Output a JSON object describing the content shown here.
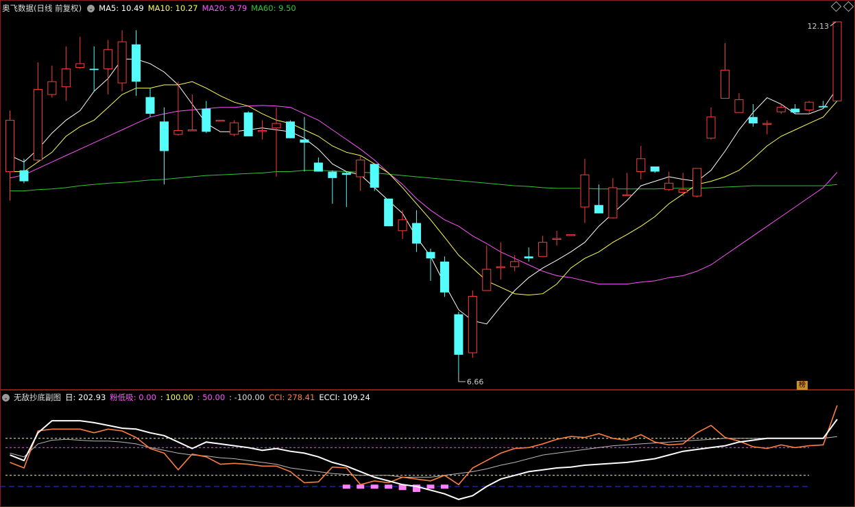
{
  "header": {
    "title": "奥飞数据(日线 前复权)",
    "ma5": "MA5: 10.49",
    "ma10": "MA10: 10.27",
    "ma20": "MA20: 9.79",
    "ma60": "MA60: 9.50"
  },
  "subheader": {
    "title": "无敌抄底副图",
    "ri": "日: 202.93",
    "fendixi": "粉低吸: 0.00",
    "l100": ": 100.00",
    "l50": ": 50.00",
    "lm100": ": -100.00",
    "cci": "CCI: 278.41",
    "ecci": "ECCI: 109.24"
  },
  "bang_label": "榜",
  "colors": {
    "up": "#ff3c3c",
    "down": "#54fcfc",
    "ma5": "#ffffff",
    "ma10": "#ffff54",
    "ma20": "#ff54ff",
    "ma60": "#32c832",
    "cci": "#ff7f40",
    "ri": "#ffffff",
    "pink": "#ff80ff"
  },
  "chart_data": [
    {
      "type": "candlestick",
      "high_label": "12.13",
      "low_label": "6.66",
      "candles": [
        [
          9.8,
          10.6,
          10.75,
          9.35
        ],
        [
          9.82,
          9.65,
          10.0,
          9.62
        ],
        [
          9.98,
          11.08,
          11.5,
          9.96
        ],
        [
          11.0,
          11.2,
          11.45,
          10.95
        ],
        [
          11.12,
          11.4,
          11.75,
          10.9
        ],
        [
          11.42,
          11.48,
          11.9,
          11.4
        ],
        [
          11.4,
          11.38,
          11.75,
          11.05
        ],
        [
          11.4,
          11.7,
          11.85,
          11.0
        ],
        [
          11.18,
          11.82,
          12.0,
          11.05
        ],
        [
          11.78,
          11.2,
          12.0,
          10.98
        ],
        [
          10.96,
          10.7,
          11.1,
          10.65
        ],
        [
          10.58,
          10.12,
          10.8,
          9.6
        ],
        [
          10.38,
          10.44,
          11.2,
          10.36
        ],
        [
          10.44,
          10.45,
          11.0,
          10.43
        ],
        [
          10.78,
          10.42,
          10.9,
          10.4
        ],
        [
          10.6,
          10.6,
          10.6,
          10.6
        ],
        [
          10.38,
          10.56,
          10.6,
          10.35
        ],
        [
          10.72,
          10.35,
          10.74,
          10.35
        ],
        [
          10.44,
          10.44,
          10.6,
          10.3
        ],
        [
          10.48,
          10.55,
          10.8,
          9.72
        ],
        [
          10.58,
          10.32,
          10.6,
          10.32
        ],
        [
          10.3,
          10.25,
          10.65,
          9.8
        ],
        [
          9.94,
          9.8,
          10.02,
          9.8
        ],
        [
          9.8,
          9.7,
          9.82,
          9.3
        ],
        [
          9.78,
          9.75,
          9.8,
          9.25
        ],
        [
          9.72,
          9.98,
          10.05,
          9.5
        ],
        [
          9.92,
          9.55,
          9.92,
          9.5
        ],
        [
          9.38,
          8.95,
          9.38,
          8.95
        ],
        [
          8.88,
          9.05,
          9.2,
          8.75
        ],
        [
          9.0,
          8.68,
          9.2,
          8.55
        ],
        [
          8.55,
          8.45,
          8.6,
          8.1
        ],
        [
          8.4,
          7.92,
          8.48,
          7.85
        ],
        [
          7.58,
          6.95,
          7.62,
          6.66
        ],
        [
          6.98,
          7.86,
          7.95,
          6.9
        ],
        [
          7.95,
          8.28,
          8.65,
          7.95
        ],
        [
          8.32,
          8.32,
          8.7,
          8.12
        ],
        [
          8.32,
          8.4,
          8.5,
          8.25
        ],
        [
          8.48,
          8.45,
          8.62,
          8.4
        ],
        [
          8.48,
          8.7,
          8.8,
          8.5
        ],
        [
          8.75,
          8.76,
          8.88,
          8.65
        ],
        [
          8.82,
          8.82,
          8.82,
          8.82
        ],
        [
          9.25,
          9.75,
          10.0,
          9.0
        ],
        [
          9.28,
          9.15,
          9.6,
          9.15
        ],
        [
          9.08,
          9.55,
          9.7,
          9.07
        ],
        [
          9.44,
          9.44,
          9.78,
          9.42
        ],
        [
          9.8,
          10.0,
          10.2,
          9.68
        ],
        [
          9.88,
          9.8,
          9.88,
          9.78
        ],
        [
          9.52,
          9.62,
          9.8,
          9.5
        ],
        [
          9.48,
          9.52,
          9.78,
          9.42
        ],
        [
          9.42,
          9.85,
          9.85,
          9.4
        ],
        [
          10.32,
          10.65,
          10.8,
          10.3
        ],
        [
          10.94,
          11.38,
          11.8,
          10.94
        ],
        [
          10.72,
          10.92,
          11.02,
          10.78
        ],
        [
          10.65,
          10.55,
          10.85,
          10.5
        ],
        [
          10.55,
          10.55,
          10.6,
          10.38
        ],
        [
          10.73,
          10.8,
          10.85,
          10.7
        ],
        [
          10.78,
          10.72,
          10.85,
          10.7
        ],
        [
          10.76,
          10.88,
          10.9,
          10.7
        ],
        [
          10.82,
          10.8,
          10.9,
          10.8
        ],
        [
          10.9,
          12.13,
          12.13,
          10.9
        ]
      ],
      "ma5": [
        10.05,
        9.95,
        10.15,
        10.4,
        10.6,
        10.75,
        11.05,
        11.25,
        11.55,
        11.55,
        11.48,
        11.35,
        11.15,
        10.85,
        10.55,
        10.42,
        10.42,
        10.45,
        10.48,
        10.45,
        10.42,
        10.32,
        10.15,
        9.92,
        9.8,
        9.75,
        9.55,
        9.35,
        9.15,
        8.78,
        8.48,
        8.05,
        7.65,
        7.48,
        7.43,
        7.7,
        7.95,
        8.15,
        8.3,
        8.42,
        8.55,
        8.7,
        8.95,
        9.15,
        9.35,
        9.58,
        9.65,
        9.72,
        9.68,
        9.65,
        9.82,
        10.12,
        10.45,
        10.72,
        10.95,
        10.85,
        10.7,
        10.7,
        10.78,
        11.1
      ],
      "ma10": [
        9.8,
        9.8,
        9.95,
        10.1,
        10.35,
        10.5,
        10.6,
        10.8,
        11.0,
        11.1,
        11.1,
        11.15,
        11.15,
        11.2,
        11.1,
        10.98,
        10.88,
        10.82,
        10.7,
        10.6,
        10.55,
        10.45,
        10.35,
        10.2,
        10.1,
        10.05,
        9.92,
        9.78,
        9.55,
        9.3,
        9.05,
        8.78,
        8.5,
        8.3,
        8.1,
        8.0,
        7.9,
        7.88,
        7.9,
        8.05,
        8.3,
        8.45,
        8.55,
        8.7,
        8.82,
        8.95,
        9.1,
        9.3,
        9.45,
        9.6,
        9.65,
        9.72,
        9.82,
        10.0,
        10.2,
        10.35,
        10.45,
        10.55,
        10.65,
        10.9
      ],
      "ma20": [
        9.7,
        9.75,
        9.85,
        9.95,
        10.05,
        10.15,
        10.25,
        10.35,
        10.45,
        10.55,
        10.65,
        10.7,
        10.74,
        10.76,
        10.78,
        10.8,
        10.8,
        10.82,
        10.83,
        10.82,
        10.8,
        10.7,
        10.6,
        10.45,
        10.3,
        10.15,
        9.98,
        9.78,
        9.6,
        9.38,
        9.2,
        9.05,
        8.95,
        8.8,
        8.68,
        8.55,
        8.45,
        8.35,
        8.25,
        8.18,
        8.15,
        8.1,
        8.05,
        8.05,
        8.05,
        8.08,
        8.1,
        8.15,
        8.18,
        8.25,
        8.35,
        8.5,
        8.65,
        8.8,
        8.95,
        9.1,
        9.25,
        9.4,
        9.55,
        9.79
      ],
      "ma60": [
        9.5,
        9.5,
        9.52,
        9.53,
        9.55,
        9.58,
        9.6,
        9.62,
        9.63,
        9.65,
        9.67,
        9.68,
        9.7,
        9.72,
        9.74,
        9.75,
        9.76,
        9.77,
        9.78,
        9.8,
        9.8,
        9.82,
        9.82,
        9.81,
        9.8,
        9.79,
        9.78,
        9.76,
        9.74,
        9.72,
        9.7,
        9.68,
        9.66,
        9.64,
        9.62,
        9.6,
        9.58,
        9.57,
        9.55,
        9.54,
        9.54,
        9.54,
        9.53,
        9.53,
        9.53,
        9.53,
        9.53,
        9.54,
        9.54,
        9.54,
        9.55,
        9.56,
        9.57,
        9.58,
        9.58,
        9.58,
        9.58,
        9.58,
        9.58,
        9.6
      ],
      "ylim": [
        6.5,
        12.3
      ]
    },
    {
      "type": "line",
      "series_names": [
        "日",
        "CCI",
        "ECCI",
        "粉低吸"
      ],
      "levels": [
        100,
        50,
        -100
      ],
      "ylim": [
        -260,
        340
      ],
      "ri": [
        10,
        -20,
        130,
        195,
        195,
        195,
        185,
        170,
        155,
        150,
        130,
        115,
        80,
        45,
        80,
        70,
        60,
        50,
        35,
        45,
        30,
        20,
        0,
        -30,
        -50,
        -80,
        -110,
        -130,
        -150,
        -160,
        -180,
        -200,
        -230,
        -210,
        -160,
        -120,
        -100,
        -80,
        -70,
        -60,
        -55,
        -45,
        -40,
        -35,
        -30,
        -20,
        -10,
        10,
        30,
        40,
        50,
        60,
        80,
        90,
        100,
        100,
        100,
        100,
        100,
        202.93
      ],
      "cci": [
        -30,
        -60,
        140,
        150,
        150,
        150,
        130,
        150,
        140,
        105,
        45,
        20,
        -70,
        15,
        0,
        -40,
        -35,
        -40,
        -50,
        -50,
        -80,
        -140,
        -135,
        -55,
        -60,
        -150,
        -130,
        -140,
        -110,
        -120,
        -130,
        -100,
        -150,
        -60,
        -20,
        20,
        45,
        50,
        70,
        95,
        110,
        105,
        125,
        100,
        90,
        120,
        80,
        65,
        70,
        130,
        170,
        105,
        85,
        55,
        45,
        65,
        50,
        60,
        65,
        278.41
      ],
      "ecci": [
        20,
        0,
        70,
        90,
        95,
        90,
        85,
        85,
        80,
        70,
        50,
        35,
        20,
        10,
        5,
        -5,
        -10,
        -20,
        -30,
        -40,
        -60,
        -70,
        -80,
        -90,
        -95,
        -100,
        -100,
        -100,
        -110,
        -110,
        -110,
        -100,
        -90,
        -80,
        -65,
        -45,
        -30,
        -10,
        10,
        20,
        30,
        40,
        50,
        60,
        65,
        70,
        75,
        80,
        85,
        90,
        95,
        100,
        100,
        100,
        100,
        100,
        100,
        100,
        100,
        109.24
      ],
      "pink": [
        0,
        0,
        0,
        0,
        0,
        0,
        0,
        0,
        0,
        0,
        0,
        0,
        0,
        0,
        0,
        0,
        0,
        0,
        0,
        0,
        0,
        0,
        0,
        0,
        -120,
        -130,
        -130,
        -140,
        -150,
        -160,
        -140,
        -120,
        0,
        0,
        0,
        0,
        0,
        0,
        0,
        0,
        0,
        0,
        0,
        0,
        0,
        0,
        0,
        0,
        0,
        0,
        0,
        0,
        0,
        0,
        0,
        0,
        0,
        0,
        0,
        0
      ]
    }
  ]
}
